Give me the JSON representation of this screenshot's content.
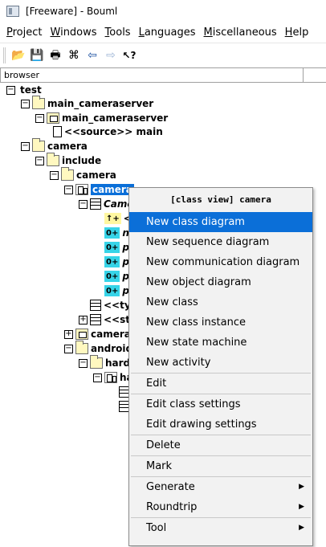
{
  "window": {
    "title": "[Freeware] - Bouml"
  },
  "menubar": {
    "items": [
      {
        "label": "Project",
        "mnemonic": "P"
      },
      {
        "label": "Windows",
        "mnemonic": "W"
      },
      {
        "label": "Tools",
        "mnemonic": "T"
      },
      {
        "label": "Languages",
        "mnemonic": "L"
      },
      {
        "label": "Miscellaneous",
        "mnemonic": "M"
      },
      {
        "label": "Help",
        "mnemonic": "H"
      }
    ]
  },
  "toolbar": {
    "buttons": [
      {
        "name": "open-folder-icon",
        "glyph": "📂"
      },
      {
        "name": "save-icon",
        "glyph": "💾"
      },
      {
        "name": "print-icon",
        "glyph": "🖶"
      },
      {
        "name": "find-icon",
        "glyph": "⌘"
      },
      {
        "name": "back-arrow-icon",
        "glyph": "⇦"
      },
      {
        "name": "forward-arrow-icon",
        "glyph": "⇨"
      },
      {
        "name": "whats-this-help-icon",
        "glyph": "↖?"
      }
    ]
  },
  "browser": {
    "header": "browser"
  },
  "tree": {
    "nodes": [
      {
        "id": "test",
        "label": "test"
      },
      {
        "id": "main_cameraserver_folder",
        "label": "main_cameraserver"
      },
      {
        "id": "main_cameraserver_pkg",
        "label": "main_cameraserver"
      },
      {
        "id": "source_main",
        "label": "<<source>> main"
      },
      {
        "id": "camera_folder",
        "label": "camera"
      },
      {
        "id": "include_folder",
        "label": "include"
      },
      {
        "id": "camera_include_folder",
        "label": "camera"
      },
      {
        "id": "camera_classview",
        "label": "camera"
      },
      {
        "id": "camera_class",
        "label": "Came"
      },
      {
        "id": "attr_g",
        "label": "<<g",
        "tag": "↑+"
      },
      {
        "id": "attr_no",
        "label": "no",
        "tag": "0+"
      },
      {
        "id": "attr_po1",
        "label": "po",
        "tag": "0+"
      },
      {
        "id": "attr_po2",
        "label": "po",
        "tag": "0+"
      },
      {
        "id": "attr_po3",
        "label": "po",
        "tag": "0+"
      },
      {
        "id": "attr_po4",
        "label": "po",
        "tag": "0+"
      },
      {
        "id": "typ_class",
        "label": "<<typ"
      },
      {
        "id": "str_class",
        "label": "<<str"
      },
      {
        "id": "camera_pkg2",
        "label": "camera"
      },
      {
        "id": "android_folder",
        "label": "android"
      },
      {
        "id": "hardw_folder",
        "label": "hardw"
      },
      {
        "id": "ha_classview",
        "label": "ha"
      }
    ]
  },
  "context_menu": {
    "title": "[class view] camera",
    "items": [
      {
        "label": "New class diagram",
        "highlighted": true
      },
      {
        "label": "New sequence diagram"
      },
      {
        "label": "New communication diagram"
      },
      {
        "label": "New object diagram"
      },
      {
        "label": "New class"
      },
      {
        "label": "New class instance"
      },
      {
        "label": "New state machine"
      },
      {
        "label": "New activity"
      },
      {
        "label": "Edit"
      },
      {
        "label": "Edit class settings"
      },
      {
        "label": "Edit drawing settings"
      },
      {
        "label": "Delete"
      },
      {
        "label": "Mark"
      },
      {
        "label": "Generate",
        "submenu": true
      },
      {
        "label": "Roundtrip",
        "submenu": true
      },
      {
        "label": "Tool",
        "submenu": true
      }
    ]
  },
  "colors": {
    "selection": "#0b6fd8",
    "folder": "#fff8c0",
    "attribute_tag": "#37d4e8"
  }
}
